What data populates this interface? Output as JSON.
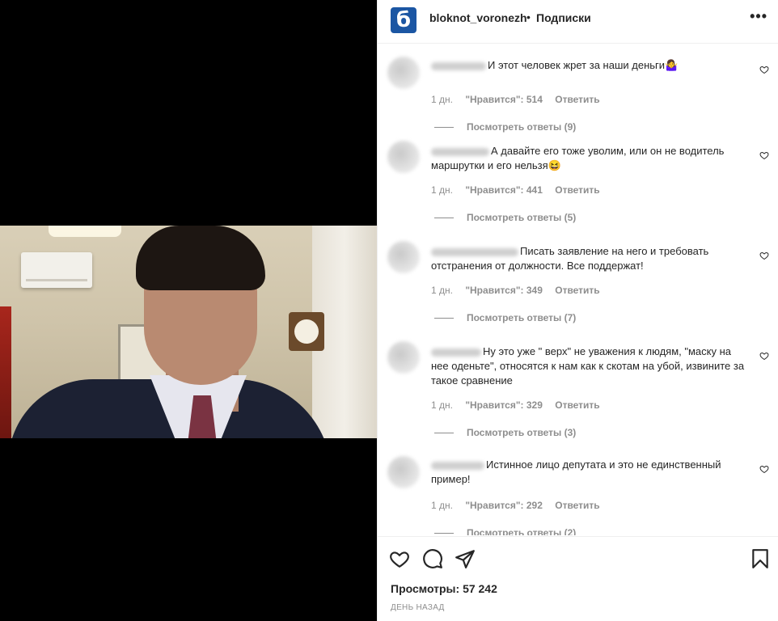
{
  "post": {
    "username": "bloknot_voronezh",
    "separator": "•",
    "follow_state": "Подписки",
    "logo_letter": "б",
    "more": "•••"
  },
  "comments": [
    {
      "text": "И этот человек жрет за наши деньги🤷‍♀️",
      "age": "1 дн.",
      "likes": "\"Нравится\": 514",
      "reply": "Ответить",
      "replies": "Посмотреть ответы (9)"
    },
    {
      "text": "А давайте его тоже уволим, или он не водитель маршрутки и его нельзя😆",
      "age": "1 дн.",
      "likes": "\"Нравится\": 441",
      "reply": "Ответить",
      "replies": "Посмотреть ответы (5)"
    },
    {
      "text": "Писать заявление на него и требовать отстранения от должности. Все поддержат!",
      "age": "1 дн.",
      "likes": "\"Нравится\": 349",
      "reply": "Ответить",
      "replies": "Посмотреть ответы (7)"
    },
    {
      "text": "Ну это уже \" верх\" не уважения к людям, \"маску на нее оденьте\", относятся к нам как к скотам на убой, извините за такое сравнение",
      "age": "1 дн.",
      "likes": "\"Нравится\": 329",
      "reply": "Ответить",
      "replies": "Посмотреть ответы (3)"
    },
    {
      "text": "Истинное лицо депутата и это не единственный пример!",
      "age": "1 дн.",
      "likes": "\"Нравится\": 292",
      "reply": "Ответить",
      "replies": "Посмотреть ответы (2)"
    }
  ],
  "footer": {
    "views_label": "Просмотры:",
    "views_count": "57 242",
    "posted": "ДЕНЬ НАЗАД"
  },
  "icons": [
    "heart-icon",
    "comment-icon",
    "share-icon",
    "bookmark-icon",
    "more-icon"
  ]
}
